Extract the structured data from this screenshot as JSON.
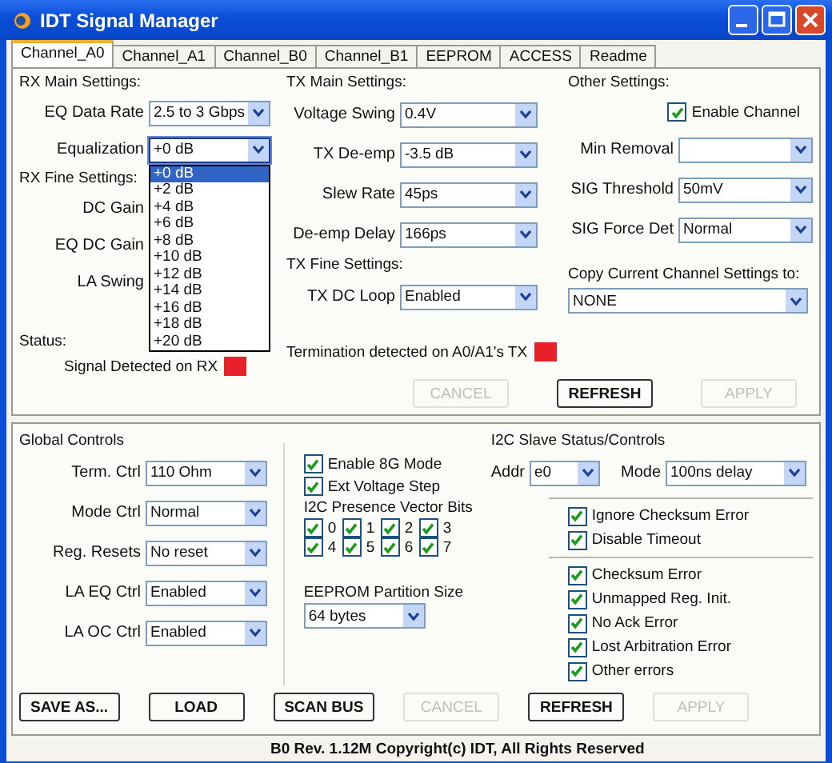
{
  "window": {
    "title": "IDT Signal Manager"
  },
  "tabs": [
    {
      "label": "Channel_A0",
      "selected": true
    },
    {
      "label": "Channel_A1",
      "selected": false
    },
    {
      "label": "Channel_B0",
      "selected": false
    },
    {
      "label": "Channel_B1",
      "selected": false
    },
    {
      "label": "EEPROM",
      "selected": false
    },
    {
      "label": "ACCESS",
      "selected": false
    },
    {
      "label": "Readme",
      "selected": false
    }
  ],
  "rx_main": {
    "heading": "RX Main Settings:",
    "fields": [
      {
        "label": "EQ Data Rate",
        "value": "2.5 to 3 Gbps",
        "expanded": false
      },
      {
        "label": "Equalization",
        "value": "+0 dB",
        "expanded": true,
        "options": [
          {
            "label": "+0 dB",
            "selected": true
          },
          {
            "label": "+2 dB",
            "selected": false
          },
          {
            "label": "+4 dB",
            "selected": false
          },
          {
            "label": "+6 dB",
            "selected": false
          },
          {
            "label": "+8 dB",
            "selected": false
          },
          {
            "label": "+10 dB",
            "selected": false
          },
          {
            "label": "+12 dB",
            "selected": false
          },
          {
            "label": "+14 dB",
            "selected": false
          },
          {
            "label": "+16 dB",
            "selected": false
          },
          {
            "label": "+18 dB",
            "selected": false
          },
          {
            "label": "+20 dB",
            "selected": false
          }
        ]
      }
    ]
  },
  "rx_fine": {
    "heading": "RX Fine Settings:",
    "fields": [
      {
        "label": "DC Gain"
      },
      {
        "label": "EQ DC Gain"
      },
      {
        "label": "LA Swing"
      }
    ]
  },
  "rx_status": {
    "heading": "Status:",
    "label": "Signal Detected on RX"
  },
  "tx_main": {
    "heading": "TX Main Settings:",
    "fields": [
      {
        "label": "Voltage Swing",
        "value": "0.4V"
      },
      {
        "label": "TX De-emp",
        "value": "-3.5 dB"
      },
      {
        "label": "Slew Rate",
        "value": "45ps"
      },
      {
        "label": "De-emp Delay",
        "value": "166ps"
      }
    ]
  },
  "tx_fine": {
    "heading": "TX Fine Settings:",
    "fields": [
      {
        "label": "TX DC Loop",
        "value": "Enabled"
      }
    ]
  },
  "tx_status": {
    "label": "Termination detected on A0/A1's TX"
  },
  "other": {
    "heading": "Other Settings:",
    "enable": {
      "label": "Enable Channel",
      "checked": true
    },
    "fields": [
      {
        "label": "Min Removal"
      },
      {
        "label": "SIG Threshold",
        "value": "50mV"
      },
      {
        "label": "SIG Force Det",
        "value": "Normal"
      }
    ]
  },
  "copy": {
    "label": "Copy Current Channel Settings to:",
    "value": "NONE"
  },
  "top_buttons": [
    {
      "label": "CANCEL",
      "disabled": true
    },
    {
      "label": "REFRESH",
      "disabled": false
    },
    {
      "label": "APPLY",
      "disabled": true
    }
  ],
  "global": {
    "heading": "Global Controls",
    "fields": [
      {
        "label": "Term. Ctrl",
        "value": "110 Ohm"
      },
      {
        "label": "Mode Ctrl",
        "value": "Normal"
      },
      {
        "label": "Reg. Resets",
        "value": "No reset"
      },
      {
        "label": "LA EQ Ctrl",
        "value": "Enabled"
      },
      {
        "label": "LA OC Ctrl",
        "value": "Enabled"
      }
    ]
  },
  "modes": [
    {
      "label": "Enable 8G Mode",
      "checked": true
    },
    {
      "label": "Ext Voltage Step",
      "checked": true
    }
  ],
  "presence": {
    "heading": "I2C Presence Vector Bits",
    "bits": [
      {
        "label": "0",
        "checked": true
      },
      {
        "label": "1",
        "checked": true
      },
      {
        "label": "2",
        "checked": true
      },
      {
        "label": "3",
        "checked": true
      },
      {
        "label": "4",
        "checked": true
      },
      {
        "label": "5",
        "checked": true
      },
      {
        "label": "6",
        "checked": true
      },
      {
        "label": "7",
        "checked": true
      }
    ]
  },
  "eeprom": {
    "heading": "EEPROM Partition Size",
    "value": "64 bytes"
  },
  "i2c": {
    "heading": "I2C Slave Status/Controls",
    "addr": {
      "label": "Addr",
      "value": "e0"
    },
    "mode": {
      "label": "Mode",
      "value": "100ns delay"
    },
    "options": [
      {
        "label": "Ignore Checksum Error",
        "checked": true
      },
      {
        "label": "Disable Timeout",
        "checked": true
      }
    ],
    "errors": [
      {
        "label": "Checksum Error",
        "checked": true
      },
      {
        "label": "Unmapped Reg. Init.",
        "checked": true
      },
      {
        "label": "No Ack Error",
        "checked": true
      },
      {
        "label": "Lost Arbitration Error",
        "checked": true
      },
      {
        "label": "Other errors",
        "checked": true
      }
    ]
  },
  "buttons": [
    {
      "label": "SAVE AS...",
      "disabled": false
    },
    {
      "label": "LOAD",
      "disabled": false
    },
    {
      "label": "SCAN BUS",
      "disabled": false
    },
    {
      "label": "CANCEL",
      "disabled": true
    },
    {
      "label": "REFRESH",
      "disabled": false
    },
    {
      "label": "APPLY",
      "disabled": true
    }
  ],
  "status_bar": "B0 Rev. 1.12M Copyright(c) IDT, All Rights Reserved"
}
